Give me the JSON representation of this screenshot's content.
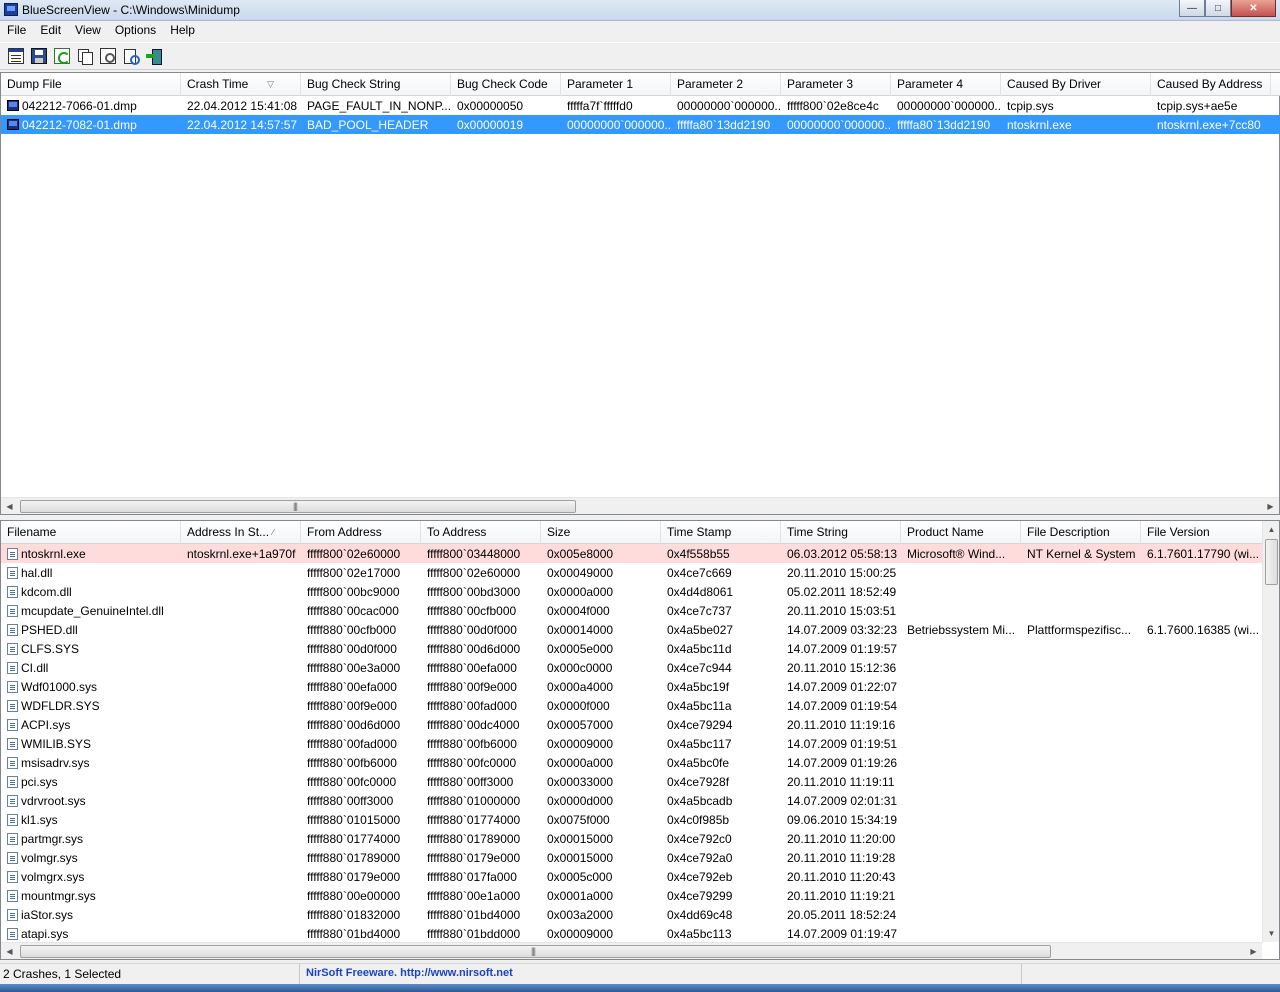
{
  "window": {
    "title": "BlueScreenView  -  C:\\Windows\\Minidump",
    "btn_min": "—",
    "btn_max": "□",
    "btn_close": "✕"
  },
  "menu": [
    "File",
    "Edit",
    "View",
    "Options",
    "Help"
  ],
  "toolbar": [
    "properties-icon",
    "save-icon",
    "refresh-icon",
    "copy-icon",
    "options-icon",
    "find-icon",
    "exit-icon"
  ],
  "crashes": {
    "columns": [
      "Dump File",
      "Crash Time",
      "Bug Check String",
      "Bug Check Code",
      "Parameter 1",
      "Parameter 2",
      "Parameter 3",
      "Parameter 4",
      "Caused By Driver",
      "Caused By Address",
      ""
    ],
    "sort_indicator": "▽",
    "rows": [
      [
        "042212-7066-01.dmp",
        "22.04.2012 15:41:08",
        "PAGE_FAULT_IN_NONP...",
        "0x00000050",
        "fffffa7f`fffffd0",
        "00000000`000000...",
        "fffff800`02e8ce4c",
        "00000000`000000...",
        "tcpip.sys",
        "tcpip.sys+ae5e",
        ""
      ],
      [
        "042212-7082-01.dmp",
        "22.04.2012 14:57:57",
        "BAD_POOL_HEADER",
        "0x00000019",
        "00000000`000000...",
        "fffffa80`13dd2190",
        "00000000`000000...",
        "fffffa80`13dd2190",
        "ntoskrnl.exe",
        "ntoskrnl.exe+7cc80",
        ""
      ]
    ],
    "selected_row": 1
  },
  "drivers": {
    "columns": [
      "Filename",
      "Address In St...",
      "From Address",
      "To Address",
      "Size",
      "Time Stamp",
      "Time String",
      "Product Name",
      "File Description",
      "File Version"
    ],
    "sort_indicator": "∕",
    "rows": [
      [
        "ntoskrnl.exe",
        "ntoskrnl.exe+1a970f",
        "fffff800`02e60000",
        "fffff800`03448000",
        "0x005e8000",
        "0x4f558b55",
        "06.03.2012 05:58:13",
        "Microsoft® Wind...",
        "NT Kernel & System",
        "6.1.7601.17790 (wi..."
      ],
      [
        "hal.dll",
        "",
        "fffff800`02e17000",
        "fffff800`02e60000",
        "0x00049000",
        "0x4ce7c669",
        "20.11.2010 15:00:25",
        "",
        "",
        ""
      ],
      [
        "kdcom.dll",
        "",
        "fffff800`00bc9000",
        "fffff800`00bd3000",
        "0x0000a000",
        "0x4d4d8061",
        "05.02.2011 18:52:49",
        "",
        "",
        ""
      ],
      [
        "mcupdate_GenuineIntel.dll",
        "",
        "fffff880`00cac000",
        "fffff880`00cfb000",
        "0x0004f000",
        "0x4ce7c737",
        "20.11.2010 15:03:51",
        "",
        "",
        ""
      ],
      [
        "PSHED.dll",
        "",
        "fffff880`00cfb000",
        "fffff880`00d0f000",
        "0x00014000",
        "0x4a5be027",
        "14.07.2009 03:32:23",
        "Betriebssystem Mi...",
        "Plattformspezifisc...",
        "6.1.7600.16385 (wi..."
      ],
      [
        "CLFS.SYS",
        "",
        "fffff880`00d0f000",
        "fffff880`00d6d000",
        "0x0005e000",
        "0x4a5bc11d",
        "14.07.2009 01:19:57",
        "",
        "",
        ""
      ],
      [
        "CI.dll",
        "",
        "fffff880`00e3a000",
        "fffff880`00efa000",
        "0x000c0000",
        "0x4ce7c944",
        "20.11.2010 15:12:36",
        "",
        "",
        ""
      ],
      [
        "Wdf01000.sys",
        "",
        "fffff880`00efa000",
        "fffff880`00f9e000",
        "0x000a4000",
        "0x4a5bc19f",
        "14.07.2009 01:22:07",
        "",
        "",
        ""
      ],
      [
        "WDFLDR.SYS",
        "",
        "fffff880`00f9e000",
        "fffff880`00fad000",
        "0x0000f000",
        "0x4a5bc11a",
        "14.07.2009 01:19:54",
        "",
        "",
        ""
      ],
      [
        "ACPI.sys",
        "",
        "fffff880`00d6d000",
        "fffff880`00dc4000",
        "0x00057000",
        "0x4ce79294",
        "20.11.2010 11:19:16",
        "",
        "",
        ""
      ],
      [
        "WMILIB.SYS",
        "",
        "fffff880`00fad000",
        "fffff880`00fb6000",
        "0x00009000",
        "0x4a5bc117",
        "14.07.2009 01:19:51",
        "",
        "",
        ""
      ],
      [
        "msisadrv.sys",
        "",
        "fffff880`00fb6000",
        "fffff880`00fc0000",
        "0x0000a000",
        "0x4a5bc0fe",
        "14.07.2009 01:19:26",
        "",
        "",
        ""
      ],
      [
        "pci.sys",
        "",
        "fffff880`00fc0000",
        "fffff880`00ff3000",
        "0x00033000",
        "0x4ce7928f",
        "20.11.2010 11:19:11",
        "",
        "",
        ""
      ],
      [
        "vdrvroot.sys",
        "",
        "fffff880`00ff3000",
        "fffff880`01000000",
        "0x0000d000",
        "0x4a5bcadb",
        "14.07.2009 02:01:31",
        "",
        "",
        ""
      ],
      [
        "kl1.sys",
        "",
        "fffff880`01015000",
        "fffff880`01774000",
        "0x0075f000",
        "0x4c0f985b",
        "09.06.2010 15:34:19",
        "",
        "",
        ""
      ],
      [
        "partmgr.sys",
        "",
        "fffff880`01774000",
        "fffff880`01789000",
        "0x00015000",
        "0x4ce792c0",
        "20.11.2010 11:20:00",
        "",
        "",
        ""
      ],
      [
        "volmgr.sys",
        "",
        "fffff880`01789000",
        "fffff880`0179e000",
        "0x00015000",
        "0x4ce792a0",
        "20.11.2010 11:19:28",
        "",
        "",
        ""
      ],
      [
        "volmgrx.sys",
        "",
        "fffff880`0179e000",
        "fffff880`017fa000",
        "0x0005c000",
        "0x4ce792eb",
        "20.11.2010 11:20:43",
        "",
        "",
        ""
      ],
      [
        "mountmgr.sys",
        "",
        "fffff880`00e00000",
        "fffff880`00e1a000",
        "0x0001a000",
        "0x4ce79299",
        "20.11.2010 11:19:21",
        "",
        "",
        ""
      ],
      [
        "iaStor.sys",
        "",
        "fffff880`01832000",
        "fffff880`01bd4000",
        "0x003a2000",
        "0x4dd69c48",
        "20.05.2011 18:52:24",
        "",
        "",
        ""
      ],
      [
        "atapi.sys",
        "",
        "fffff880`01bd4000",
        "fffff880`01bdd000",
        "0x00009000",
        "0x4a5bc113",
        "14.07.2009 01:19:47",
        "",
        "",
        ""
      ]
    ],
    "highlighted_row": 0
  },
  "scroll": {
    "left_arrow": "◀",
    "right_arrow": "▶",
    "up_arrow": "▲",
    "down_arrow": "▼",
    "grip": "|||"
  },
  "status": {
    "count": "2 Crashes, 1 Selected",
    "credit": "NirSoft Freeware.  http://www.nirsoft.net"
  },
  "colors": {
    "selection": "#3399ff",
    "highlight": "#ffdcdc",
    "link": "#1a44c7"
  }
}
